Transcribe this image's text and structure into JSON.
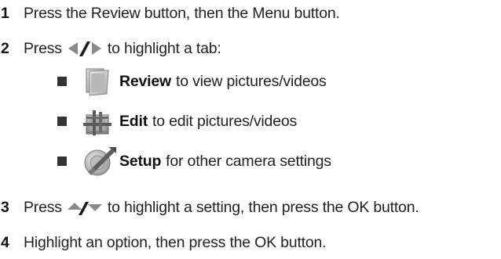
{
  "steps": {
    "s1": {
      "num": "1",
      "text": "Press the Review button, then the Menu button."
    },
    "s2": {
      "num": "2",
      "before": "Press",
      "after": "to highlight a tab:"
    },
    "s3": {
      "num": "3",
      "before": "Press",
      "after": "to highlight a setting, then press the OK button."
    },
    "s4": {
      "num": "4",
      "text": "Highlight an option, then press the OK button."
    }
  },
  "tabs": [
    {
      "name": "Review",
      "desc": "to view pictures/videos",
      "icon": "review-tab-icon"
    },
    {
      "name": "Edit",
      "desc": "to edit pictures/videos",
      "icon": "edit-tab-icon"
    },
    {
      "name": "Setup",
      "desc": "for other camera settings",
      "icon": "setup-tab-icon"
    }
  ],
  "icons": {
    "left_right": "left-right-arrows-icon",
    "up_down": "up-down-arrows-icon"
  },
  "colors": {
    "text": "#222222",
    "bullet": "#333333",
    "arrow": "#8a8a8a"
  }
}
